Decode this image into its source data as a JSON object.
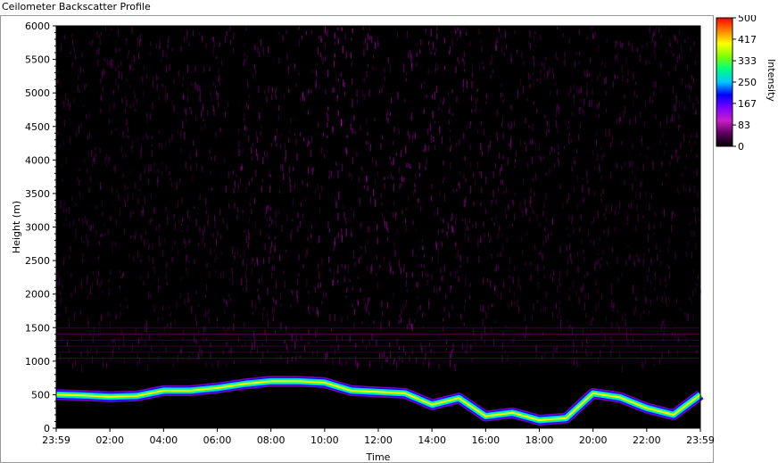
{
  "window": {
    "title": "Ceilometer Backscatter Profile"
  },
  "chart_data": {
    "type": "heatmap",
    "title": "Ceilometer Backscatter Profile",
    "xlabel": "Time",
    "ylabel": "Height (m)",
    "x_ticks": [
      "23:59",
      "02:00",
      "04:00",
      "06:00",
      "08:00",
      "10:00",
      "12:00",
      "14:00",
      "16:00",
      "18:00",
      "20:00",
      "22:00",
      "23:59"
    ],
    "y_ticks": [
      0,
      500,
      1000,
      1500,
      2000,
      2500,
      3000,
      3500,
      4000,
      4500,
      5000,
      5500,
      6000
    ],
    "ylim": [
      0,
      6000
    ],
    "colorbar": {
      "label": "Intensity",
      "ticks": [
        500,
        417,
        333,
        250,
        167,
        83,
        0
      ],
      "range": [
        0,
        500
      ],
      "colors": [
        "#000000",
        "#5a005a",
        "#c81ec8",
        "#7a00ff",
        "#0000ff",
        "#00c8ff",
        "#00ff80",
        "#80ff00",
        "#ffff00",
        "#ff8000",
        "#ff0000"
      ]
    },
    "cloud_layer_height_m": [
      {
        "time": "00:00",
        "height": 500
      },
      {
        "time": "01:00",
        "height": 490
      },
      {
        "time": "02:00",
        "height": 470
      },
      {
        "time": "03:00",
        "height": 480
      },
      {
        "time": "04:00",
        "height": 560
      },
      {
        "time": "05:00",
        "height": 560
      },
      {
        "time": "06:00",
        "height": 600
      },
      {
        "time": "07:00",
        "height": 660
      },
      {
        "time": "08:00",
        "height": 700
      },
      {
        "time": "09:00",
        "height": 700
      },
      {
        "time": "10:00",
        "height": 680
      },
      {
        "time": "11:00",
        "height": 560
      },
      {
        "time": "12:00",
        "height": 540
      },
      {
        "time": "13:00",
        "height": 520
      },
      {
        "time": "14:00",
        "height": 350
      },
      {
        "time": "15:00",
        "height": 450
      },
      {
        "time": "16:00",
        "height": 180
      },
      {
        "time": "17:00",
        "height": 230
      },
      {
        "time": "18:00",
        "height": 120
      },
      {
        "time": "19:00",
        "height": 150
      },
      {
        "time": "20:00",
        "height": 520
      },
      {
        "time": "21:00",
        "height": 460
      },
      {
        "time": "22:00",
        "height": 300
      },
      {
        "time": "23:00",
        "height": 200
      },
      {
        "time": "23:59",
        "height": 500
      }
    ]
  }
}
